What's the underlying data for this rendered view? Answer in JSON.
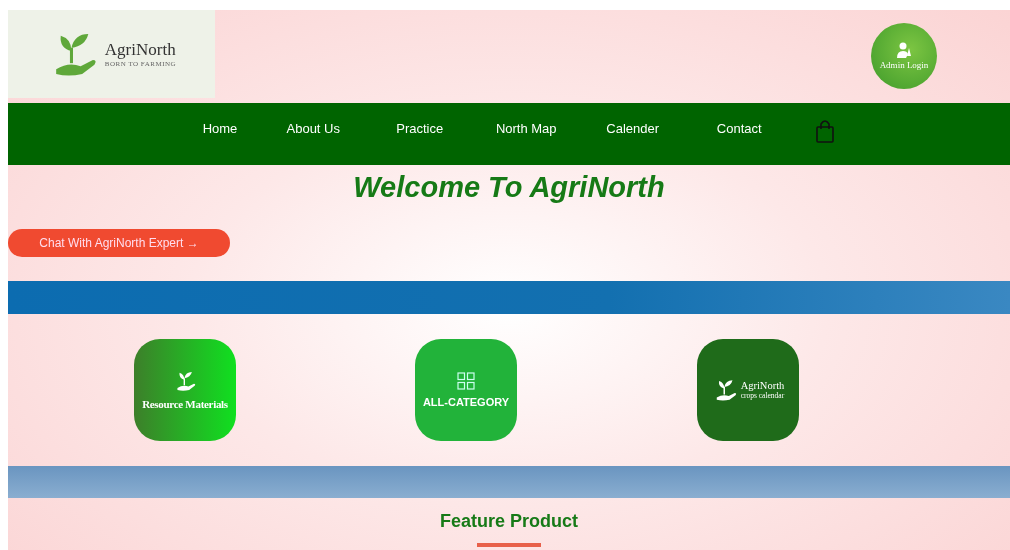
{
  "header": {
    "logo": {
      "name": "AgriNorth",
      "tagline": "BORN TO FARMING"
    },
    "admin_button": {
      "label": "Admin Login"
    }
  },
  "nav": {
    "items": [
      {
        "label": "Home"
      },
      {
        "label": "About Us"
      },
      {
        "label": "Practice"
      },
      {
        "label": "North Map"
      },
      {
        "label": "Calender"
      },
      {
        "label": "Contact"
      }
    ]
  },
  "hero": {
    "title": "Welcome To AgriNorth",
    "chat_button": "Chat With AgriNorth Expert →"
  },
  "tiles": [
    {
      "kind": "resource",
      "label": "Resource Materials"
    },
    {
      "kind": "category",
      "label": "ALL-CATEGORY"
    },
    {
      "kind": "calendar",
      "label": "AgriNorth",
      "sublabel": "crops calendar"
    }
  ],
  "feature": {
    "title": "Feature Product"
  }
}
